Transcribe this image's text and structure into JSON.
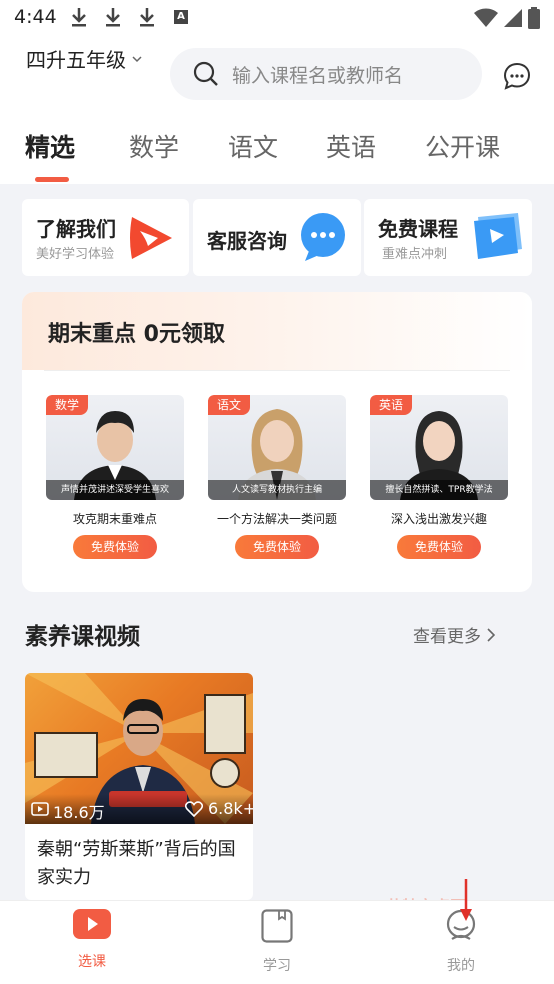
{
  "status_bar": {
    "time": "4:44",
    "notification_letter": "A"
  },
  "header": {
    "grade_selector": "四升五年级",
    "search_placeholder": "输入课程名或教师名"
  },
  "tabs": [
    "精选",
    "数学",
    "语文",
    "英语",
    "公开课"
  ],
  "quick_links": [
    {
      "title": "了解我们",
      "subtitle": "美好学习体验"
    },
    {
      "title": "客服咨询",
      "subtitle": ""
    },
    {
      "title": "免费课程",
      "subtitle": "重难点冲刺"
    }
  ],
  "promo": {
    "title": "期末重点 0元领取",
    "courses": [
      {
        "badge": "数学",
        "caption": "声情并茂讲述深受学生喜欢",
        "name": "攻克期末重难点",
        "button": "免费体验"
      },
      {
        "badge": "语文",
        "caption": "人文读写教材执行主编",
        "name": "一个方法解决一类问题",
        "button": "免费体验"
      },
      {
        "badge": "英语",
        "caption": "擅长自然拼读、TPR教学法",
        "name": "深入浅出激发兴趣",
        "button": "免费体验"
      }
    ]
  },
  "section": {
    "title": "素养课视频",
    "more": "查看更多"
  },
  "videos": [
    {
      "views": "18.6万",
      "likes": "6.8k+",
      "title": "秦朝“劳斯莱斯”背后的国家实力"
    }
  ],
  "bottom_nav": [
    {
      "label": "选课",
      "active": true
    },
    {
      "label": "学习",
      "active": false
    },
    {
      "label": "我的",
      "active": false
    }
  ],
  "watermark": "艾特安卓网",
  "colors": {
    "accent": "#f25c43",
    "blue": "#3a9af5",
    "background": "#f2f3f7"
  }
}
